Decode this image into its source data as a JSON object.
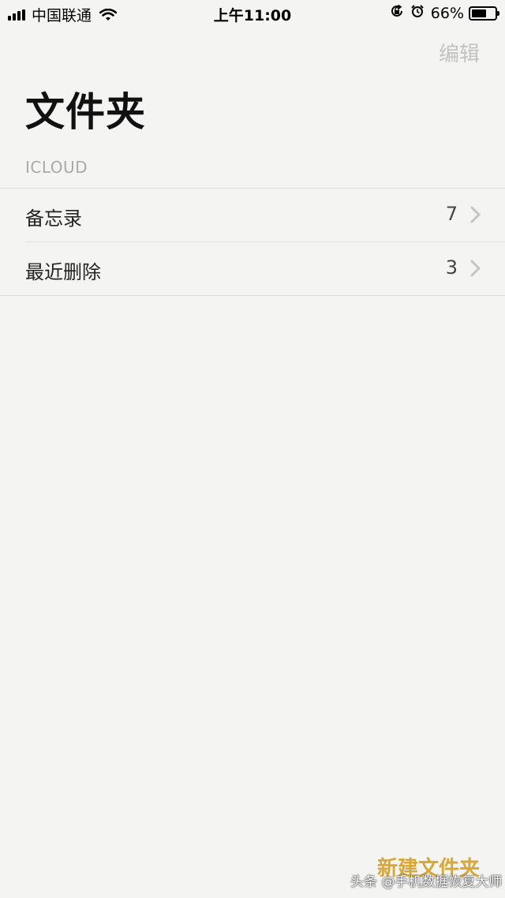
{
  "status_bar": {
    "carrier": "中国联通",
    "time": "上午11:00",
    "battery_percent": "66%",
    "battery_level": 0.66,
    "icons": [
      "signal-icon",
      "wifi-icon",
      "orientation-lock-icon",
      "alarm-icon",
      "battery-icon"
    ]
  },
  "nav": {
    "edit_label": "编辑"
  },
  "page": {
    "title": "文件夹"
  },
  "section": {
    "header": "ICLOUD",
    "folders": [
      {
        "name": "备忘录",
        "count": "7"
      },
      {
        "name": "最近删除",
        "count": "3"
      }
    ]
  },
  "toolbar": {
    "new_folder_label": "新建文件夹"
  },
  "watermark": {
    "text": "头条 @手机数据恢复大师"
  },
  "colors": {
    "background": "#f4f4f2",
    "accent": "#d6a73a",
    "disabled": "#c2c2c2",
    "separator": "#dcdcdc",
    "section_header": "#a9a9a9"
  }
}
